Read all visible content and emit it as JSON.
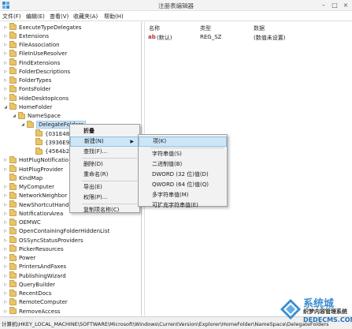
{
  "window": {
    "title": "注册表编辑器"
  },
  "menu": [
    "文件(F)",
    "编辑(E)",
    "查看(V)",
    "收藏夹(A)",
    "帮助(H)"
  ],
  "tree": [
    {
      "label": "ExecuteTypeDelegates",
      "indent": 0,
      "arrow": "▷"
    },
    {
      "label": "Extensions",
      "indent": 0,
      "arrow": "▷"
    },
    {
      "label": "FileAssociation",
      "indent": 0,
      "arrow": "▷"
    },
    {
      "label": "FileInUseResolver",
      "indent": 0,
      "arrow": "▷"
    },
    {
      "label": "FindExtensions",
      "indent": 0,
      "arrow": "▷"
    },
    {
      "label": "FolderDescriptions",
      "indent": 0,
      "arrow": "▷"
    },
    {
      "label": "FolderTypes",
      "indent": 0,
      "arrow": "▷"
    },
    {
      "label": "FontsFolder",
      "indent": 0,
      "arrow": "▷"
    },
    {
      "label": "HideDesktopIcons",
      "indent": 0,
      "arrow": "▷"
    },
    {
      "label": "HomeFolder",
      "indent": 0,
      "arrow": "◢"
    },
    {
      "label": "NameSpace",
      "indent": 1,
      "arrow": "◢"
    },
    {
      "label": "DelegateFolders",
      "indent": 2,
      "arrow": "◢",
      "selected": true
    },
    {
      "label": "{031E482",
      "indent": 3,
      "arrow": ""
    },
    {
      "label": "{3936E9E",
      "indent": 3,
      "arrow": ""
    },
    {
      "label": "{4564b25",
      "indent": 3,
      "arrow": ""
    },
    {
      "label": "HotPlugNotificatio",
      "indent": 0,
      "arrow": "▷"
    },
    {
      "label": "HotPlugProvider",
      "indent": 0,
      "arrow": "▷"
    },
    {
      "label": "KindMap",
      "indent": 0,
      "arrow": ""
    },
    {
      "label": "MyComputer",
      "indent": 0,
      "arrow": "▷"
    },
    {
      "label": "NetworkNeighbor",
      "indent": 0,
      "arrow": "▷"
    },
    {
      "label": "NewShortcutHandl",
      "indent": 0,
      "arrow": "▷"
    },
    {
      "label": "NotificationArea",
      "indent": 0,
      "arrow": "▷"
    },
    {
      "label": "OEMWC",
      "indent": 0,
      "arrow": "▷"
    },
    {
      "label": "OpenContainingFolderHiddenList",
      "indent": 0,
      "arrow": "▷"
    },
    {
      "label": "OSSyncStatusProviders",
      "indent": 0,
      "arrow": "▷"
    },
    {
      "label": "PickerResources",
      "indent": 0,
      "arrow": "▷"
    },
    {
      "label": "Power",
      "indent": 0,
      "arrow": "▷"
    },
    {
      "label": "PrintersAndFaxes",
      "indent": 0,
      "arrow": "▷"
    },
    {
      "label": "PublishingWizard",
      "indent": 0,
      "arrow": "▷"
    },
    {
      "label": "QueryBuilder",
      "indent": 0,
      "arrow": "▷"
    },
    {
      "label": "RecentDocs",
      "indent": 0,
      "arrow": "▷"
    },
    {
      "label": "RemoteComputer",
      "indent": 0,
      "arrow": "▷"
    },
    {
      "label": "RemoveAccess",
      "indent": 0,
      "arrow": "▷"
    }
  ],
  "list": {
    "headers": [
      "名称",
      "类型",
      "数据"
    ],
    "rows": [
      {
        "name": "(默认)",
        "type": "REG_SZ",
        "data": "(数值未设置)",
        "icon": "ab"
      }
    ]
  },
  "context_menu": [
    {
      "label": "折叠",
      "bold": true
    },
    {
      "label": "新建(N)",
      "submenu": true,
      "highlight": true
    },
    {
      "label": "查找(F)..."
    },
    {
      "sep": true
    },
    {
      "label": "删除(D)"
    },
    {
      "label": "重命名(R)"
    },
    {
      "sep": true
    },
    {
      "label": "导出(E)"
    },
    {
      "label": "权限(P)..."
    },
    {
      "sep": true
    },
    {
      "label": "复制项名称(C)"
    }
  ],
  "submenu": [
    {
      "label": "项(K)",
      "highlight": true
    },
    {
      "sep": true
    },
    {
      "label": "字符串值(S)"
    },
    {
      "label": "二进制值(B)"
    },
    {
      "label": "DWORD (32 位)值(D)"
    },
    {
      "label": "QWORD (64 位)值(Q)"
    },
    {
      "label": "多字符串值(M)"
    },
    {
      "label": "可扩充字符串值(E)"
    }
  ],
  "status": "计算机\\HKEY_LOCAL_MACHINE\\SOFTWARE\\Microsoft\\Windows\\CurrentVersion\\Explorer\\HomeFolder\\NameSpace\\DelegateFolders",
  "watermark": {
    "line1": "系统城",
    "line2": "织梦内容管理系统",
    "line3": "DEDECMS.COM"
  },
  "colors": {
    "accent": "#3a8cd0",
    "folder": "#e8c56a",
    "highlight": "#cde6f7"
  }
}
